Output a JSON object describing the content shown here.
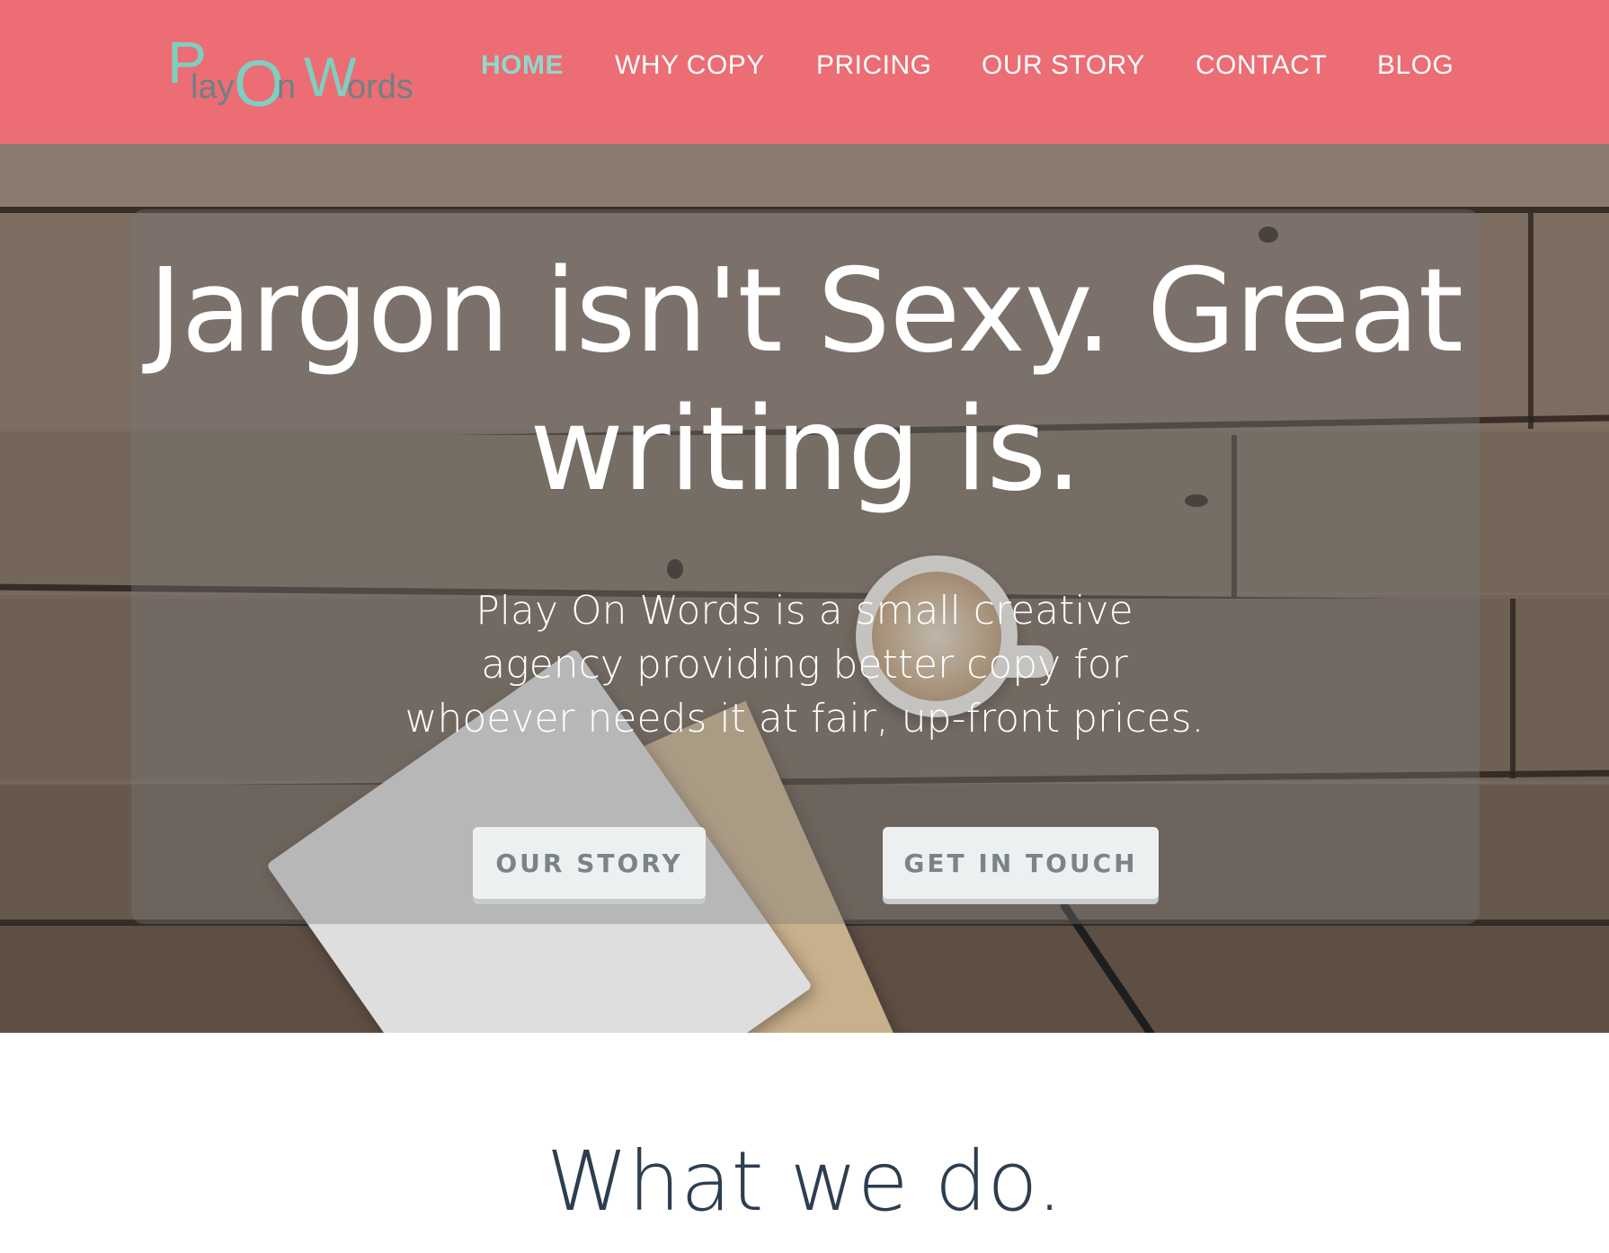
{
  "brand": {
    "logo_parts": [
      "P",
      "lay",
      "O",
      "n",
      "W",
      "ords"
    ],
    "logo_colors": {
      "accent": "#7ecfc1",
      "text": "#6f8183"
    }
  },
  "nav": {
    "items": [
      {
        "label": "HOME",
        "active": true
      },
      {
        "label": "WHY COPY",
        "active": false
      },
      {
        "label": "PRICING",
        "active": false
      },
      {
        "label": "OUR STORY",
        "active": false
      },
      {
        "label": "CONTACT",
        "active": false
      },
      {
        "label": "BLOG",
        "active": false
      }
    ]
  },
  "hero": {
    "headline_line1": "Jargon isn't Sexy. Great",
    "headline_line2": "writing is.",
    "subtext_line1": "Play On Words is a small creative",
    "subtext_line2": "agency providing better copy for",
    "subtext_line3": "whoever needs it at fair, up-front prices.",
    "buttons": {
      "our_story": "OUR STORY",
      "get_in_touch": "GET IN TOUCH"
    }
  },
  "section": {
    "title": "What we do."
  },
  "colors": {
    "header_bg": "#ec6d74",
    "nav_active": "#8fd8cd",
    "button_bg": "#edf0f1",
    "button_text": "#7a8488",
    "section_title": "#2c3e50"
  }
}
